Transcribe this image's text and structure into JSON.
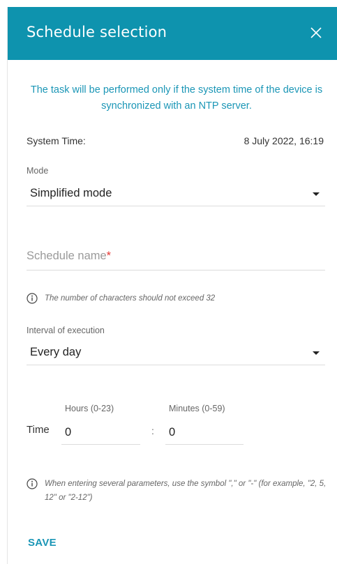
{
  "dialog": {
    "title": "Schedule selection",
    "notice": "The task will be performed only if the system time of the device is synchronized with an NTP server."
  },
  "system_time": {
    "label": "System Time:",
    "value": "8 July 2022, 16:19"
  },
  "mode": {
    "label": "Mode",
    "value": "Simplified mode"
  },
  "schedule_name": {
    "placeholder": "Schedule name",
    "required_mark": "*",
    "value": "",
    "hint": "The number of characters should not exceed 32"
  },
  "interval": {
    "label": "Interval of execution",
    "value": "Every day"
  },
  "time": {
    "label": "Time",
    "hours_label": "Hours (0-23)",
    "hours_value": "0",
    "separator": ":",
    "minutes_label": "Minutes (0-59)",
    "minutes_value": "0",
    "hint": "When entering several parameters, use the symbol \",\" or \"-\" (for example, \"2, 5, 12\" or \"2-12\")"
  },
  "actions": {
    "save_label": "SAVE"
  },
  "colors": {
    "header_bg": "#0e93ae",
    "accent_text": "#1b96b6",
    "required": "#e53935"
  }
}
